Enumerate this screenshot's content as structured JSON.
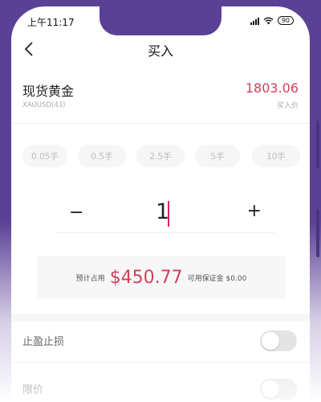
{
  "status_bar": {
    "time": "上午11:17",
    "battery": "90"
  },
  "nav": {
    "title": "买入"
  },
  "product": {
    "name": "现货黄金",
    "code": "XAUUSD(43)",
    "price": "1803.06",
    "price_label": "买入价"
  },
  "lot_options": [
    "0.05手",
    "0.5手",
    "2.5手",
    "5手",
    "10手"
  ],
  "quantity": {
    "minus": "−",
    "value": "1",
    "plus": "+"
  },
  "margin": {
    "occupied_label": "预计占用",
    "occupied_amount": "$450.77",
    "available_label": "可用保证金 $0.00"
  },
  "settings": [
    {
      "label": "止盈止损",
      "enabled": false
    },
    {
      "label": "限价",
      "enabled": false
    }
  ],
  "colors": {
    "accent": "#d0415a",
    "frame": "#5a4196",
    "caret": "#e0245e"
  }
}
